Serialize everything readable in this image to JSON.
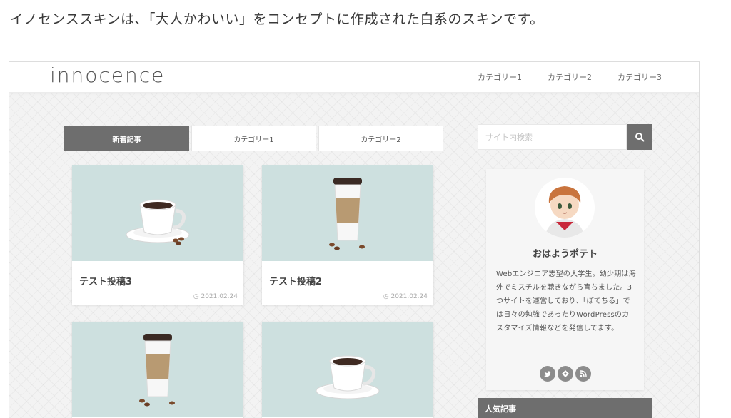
{
  "intro_text": "イノセンススキンは、「大人かわいい」をコンセプトに作成された白系のスキンです。",
  "site": {
    "logo": "innocence",
    "nav": [
      "カテゴリー1",
      "カテゴリー2",
      "カテゴリー3"
    ]
  },
  "tabs": [
    {
      "label": "新着記事",
      "active": true
    },
    {
      "label": "カテゴリー1",
      "active": false
    },
    {
      "label": "カテゴリー2",
      "active": false
    }
  ],
  "cards": [
    {
      "title": "テスト投稿3",
      "date": "2021.02.24",
      "image": "coffee-cup-icon"
    },
    {
      "title": "テスト投稿2",
      "date": "2021.02.24",
      "image": "takeaway-cup-icon"
    },
    {
      "title": "",
      "date": "",
      "image": "takeaway-cup-icon"
    },
    {
      "title": "",
      "date": "",
      "image": "coffee-cup-icon"
    }
  ],
  "search": {
    "placeholder": "サイト内検索",
    "icon": "search-icon"
  },
  "profile": {
    "name": "おはようポテト",
    "bio": "Webエンジニア志望の大学生。幼少期は海外でミスチルを聴きながら育ちました。3つサイトを運営しており、「ぽてちる」では日々の勉強であったりWordPressのカスタマイズ情報などを発信してます。",
    "sns_icons": [
      "twitter-icon",
      "feedly-icon",
      "rss-icon"
    ]
  },
  "popular_heading": "人気記事",
  "colors": {
    "accent": "#6e6e6e",
    "thumb_bg": "#cde0df",
    "page_bg": "#f3f3f3"
  }
}
